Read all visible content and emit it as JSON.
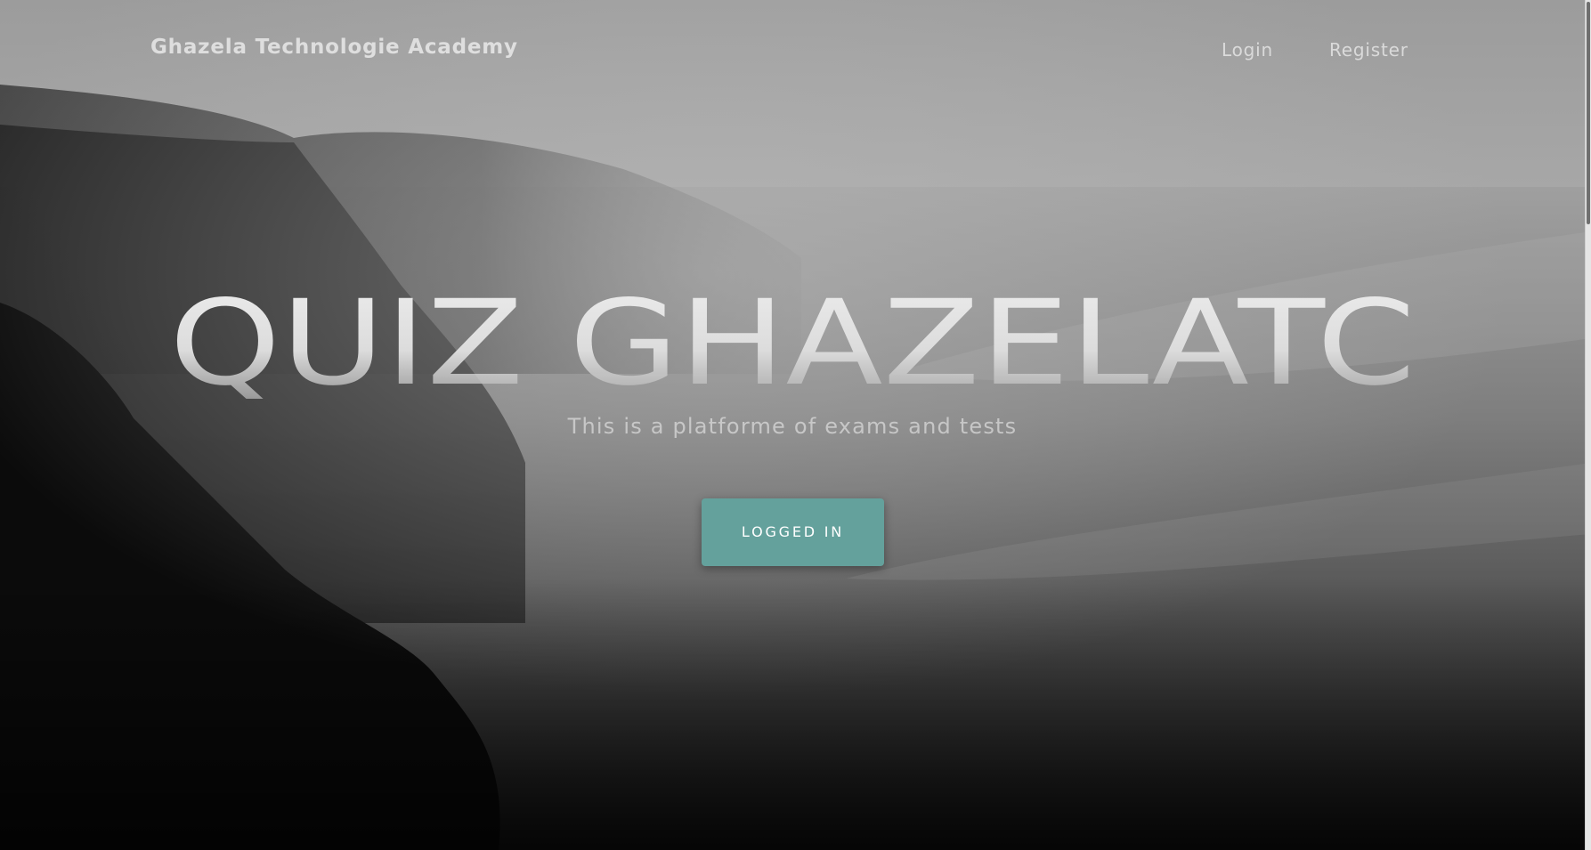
{
  "navbar": {
    "brand": "Ghazela Technologie Academy",
    "links": [
      {
        "label": "Login"
      },
      {
        "label": "Register"
      }
    ]
  },
  "hero": {
    "title": "QUIZ GHAZELATC",
    "subtitle": "This is a platforme of exams and tests",
    "button_label": "LOGGED IN"
  },
  "colors": {
    "accent": "#64a19c",
    "background_dark": "#111111",
    "background_light": "#9a9a9a"
  },
  "icons": []
}
